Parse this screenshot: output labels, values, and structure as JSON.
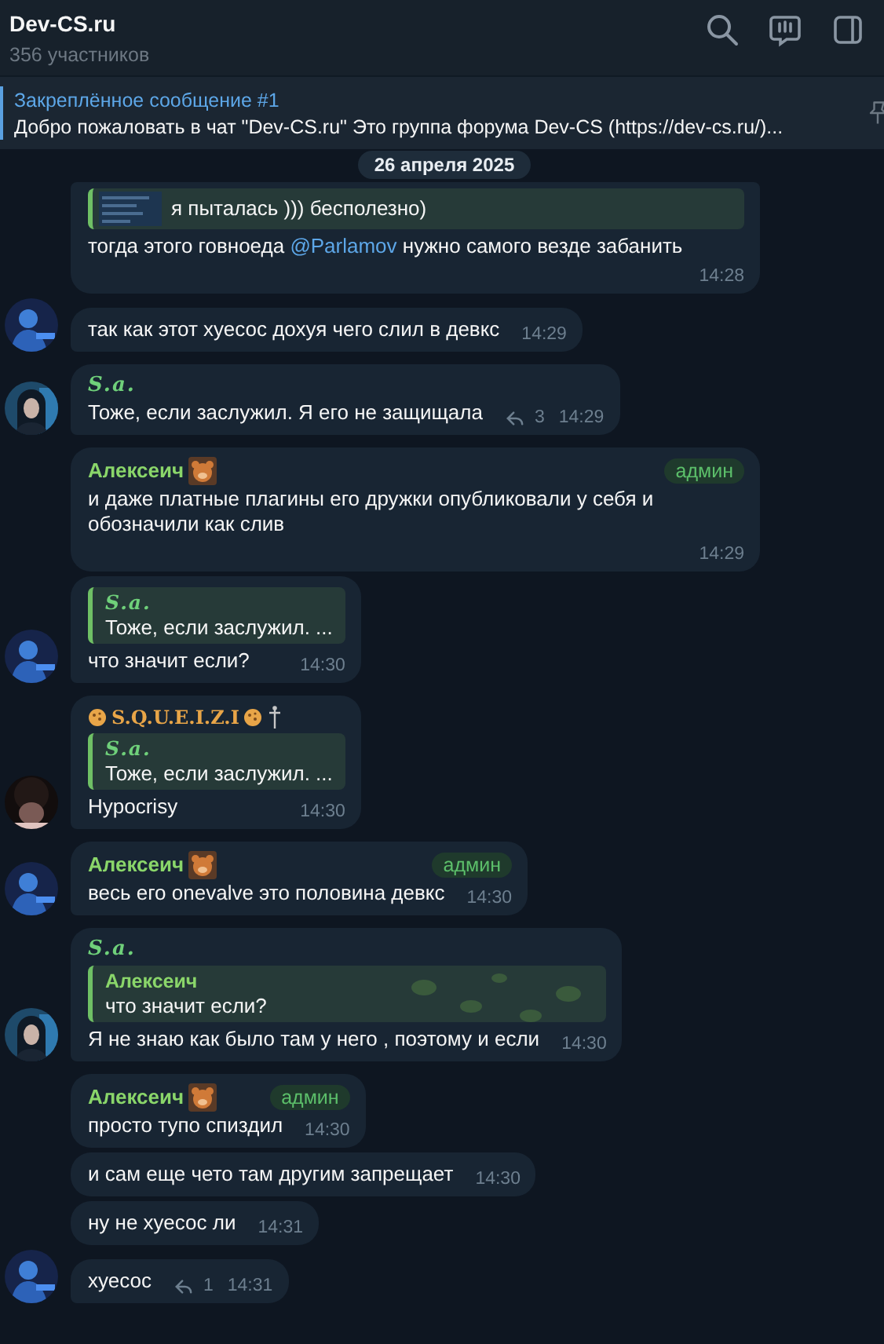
{
  "header": {
    "title": "Dev-CS.ru",
    "subtitle": "356 участников"
  },
  "pinned": {
    "title": "Закреплённое сообщение #1",
    "text": "Добро пожаловать в чат \"Dev-CS.ru\" Это группа форума Dev-CS (https://dev-cs.ru/)..."
  },
  "date": "26 апреля 2025",
  "messages": [
    {
      "reply": {
        "thumbnail": true,
        "text": "я пыталась ))) бесполезно)"
      },
      "parts": [
        {
          "kind": "plain",
          "text": "тогда этого говноеда "
        },
        {
          "kind": "mention",
          "text": "@Parlamov"
        },
        {
          "kind": "plain",
          "text": " нужно самого везде забанить"
        }
      ],
      "time": "14:28"
    },
    {
      "text": "так как этот хуесос дохуя чего слил в девкс",
      "time": "14:29",
      "avatar": {
        "kind": "glow"
      }
    },
    {
      "sender": {
        "name": "S.a.",
        "kind": "script"
      },
      "text": "Тоже, если заслужил. Я его не защищала",
      "replies": "3",
      "time": "14:29",
      "avatar": {
        "kind": "hair"
      }
    },
    {
      "sender": {
        "name": "Алексеич",
        "kind": "plain",
        "emoji": true,
        "badge": "админ"
      },
      "text": "и даже платные плагины его дружки опубликовали у себя и обозначили как слив",
      "time": "14:29"
    },
    {
      "reply": {
        "sender": "S.a.",
        "kind": "script",
        "text": "Тоже, если заслужил. ..."
      },
      "text": "что значит если?",
      "time": "14:30",
      "avatar": {
        "kind": "glow"
      }
    },
    {
      "sender": {
        "name": "S.Q.U.E.I.Z.I",
        "kind": "gold",
        "decorated": true
      },
      "reply": {
        "sender": "S.a.",
        "kind": "script",
        "text": "Тоже, если заслужил. ..."
      },
      "text": "Hypocrisy",
      "time": "14:30",
      "avatar": {
        "kind": "curly"
      }
    },
    {
      "sender": {
        "name": "Алексеич",
        "kind": "plain",
        "emoji": true,
        "badge": "админ"
      },
      "text": "весь его onevalve это половина девкс",
      "time": "14:30",
      "avatar": {
        "kind": "glow"
      }
    },
    {
      "sender": {
        "name": "S.a.",
        "kind": "script"
      },
      "reply": {
        "sender": "Алексеич",
        "kind": "plain",
        "text": "что значит если?",
        "pattern": true
      },
      "text": "Я не знаю как было там у него , поэтому и если",
      "time": "14:30",
      "avatar": {
        "kind": "hair"
      }
    },
    {
      "sender": {
        "name": "Алексеич",
        "kind": "plain",
        "emoji": true,
        "badge": "админ"
      },
      "text": "просто тупо спиздил",
      "time": "14:30"
    },
    {
      "text": "и сам еще чето там другим запрещает",
      "time": "14:30"
    },
    {
      "text": "ну не хуесос ли",
      "time": "14:31"
    },
    {
      "text": "хуесос",
      "replies": "1",
      "time": "14:31",
      "avatar": {
        "kind": "glow"
      }
    }
  ]
}
